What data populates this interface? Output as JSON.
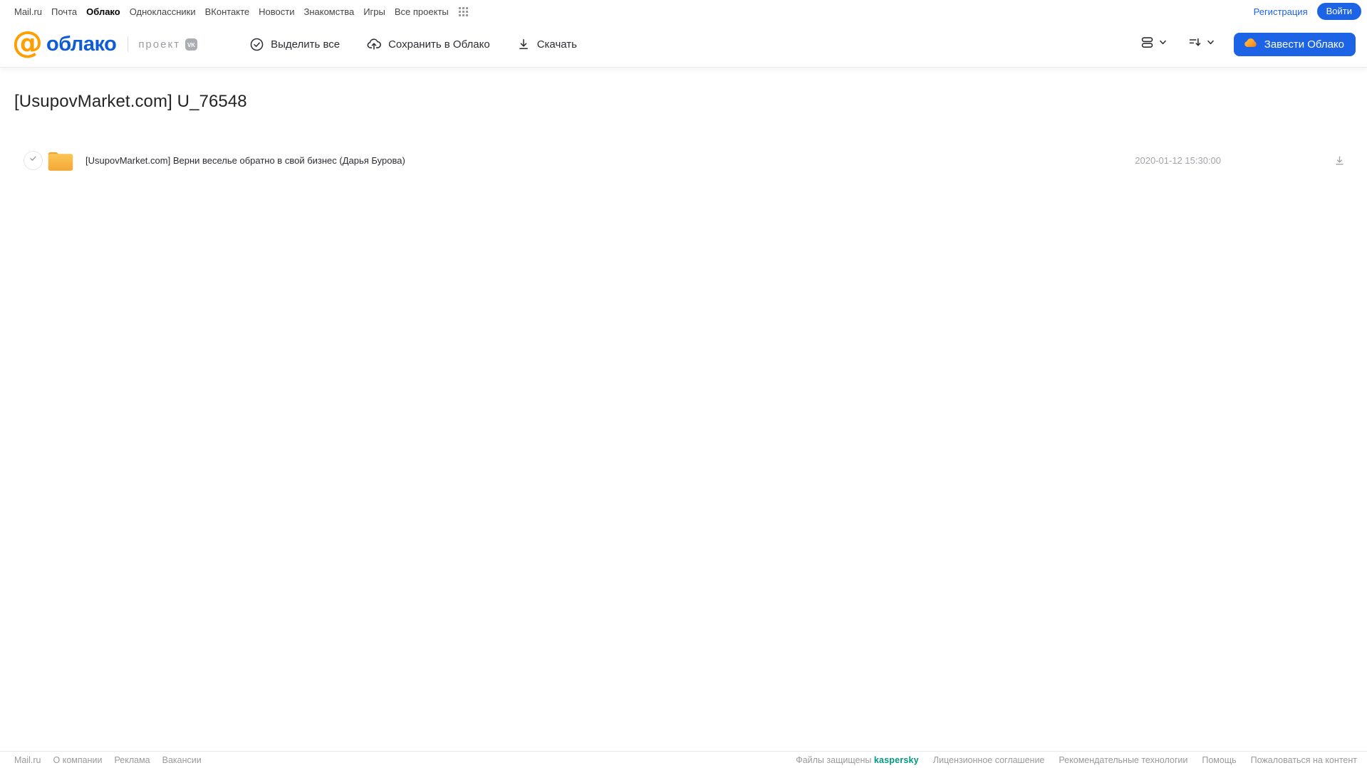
{
  "top_nav": {
    "items": [
      "Mail.ru",
      "Почта",
      "Облако",
      "Одноклассники",
      "ВКонтакте",
      "Новости",
      "Знакомства",
      "Игры",
      "Все проекты"
    ],
    "active_item": "Облако",
    "register_label": "Регистрация",
    "login_label": "Войти"
  },
  "toolbar": {
    "logo_at": "@",
    "logo_text": "облако",
    "project_label": "проект",
    "vk_badge": "VK",
    "select_all_label": "Выделить все",
    "save_to_cloud_label": "Сохранить в Облако",
    "download_label": "Скачать",
    "get_cloud_label": "Завести Облако"
  },
  "main": {
    "title": "[UsupovMarket.com] U_76548",
    "files": [
      {
        "type": "folder",
        "name": "[UsupovMarket.com] Верни веселье обратно в свой бизнес (Дарья Бурова)",
        "date": "2020-01-12 15:30:00"
      }
    ]
  },
  "footer": {
    "left_links": [
      "Mail.ru",
      "О компании",
      "Реклама",
      "Вакансии"
    ],
    "protected_label": "Файлы защищены",
    "kaspersky_label": "kaspersky",
    "right_links": [
      "Лицензионное соглашение",
      "Рекомендательные технологии",
      "Помощь",
      "Пожаловаться на контент"
    ]
  },
  "colors": {
    "accent_blue": "#1d63e6",
    "logo_blue": "#0f5cd7",
    "logo_orange": "#ff9e00",
    "folder_yellow_top": "#fcc654",
    "folder_yellow_bottom": "#f2a738",
    "kaspersky_green": "#009982",
    "muted_gray": "#9a9a9a"
  }
}
